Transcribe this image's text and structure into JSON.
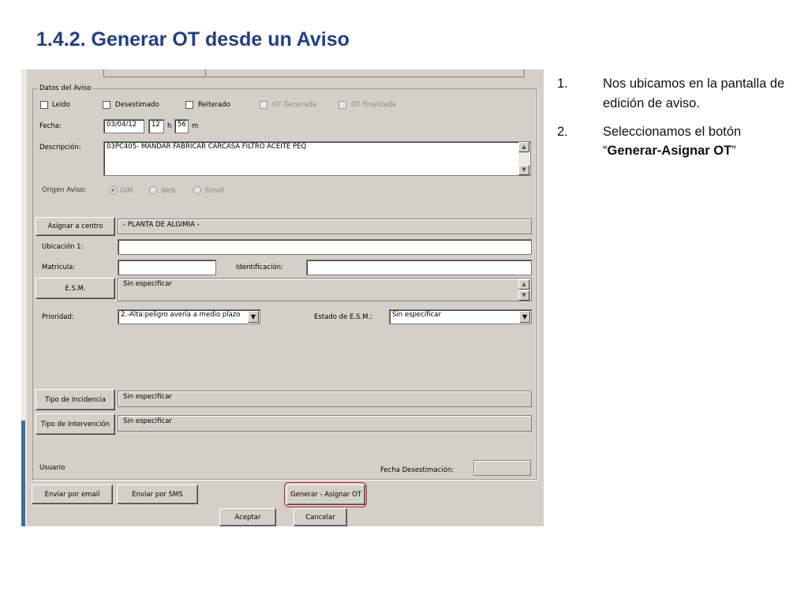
{
  "slide": {
    "title": "1.4.2. Generar OT desde un Aviso",
    "steps": [
      {
        "num": "1.",
        "text": "Nos ubicamos en la pantalla de edición de aviso."
      },
      {
        "num": "2.",
        "text_pre": "Seleccionamos el botón “",
        "text_bold": "Generar-Asignar OT",
        "text_post": "”"
      }
    ]
  },
  "form": {
    "group_label": "Datos del Aviso",
    "checkboxes": {
      "leido": "Leído",
      "desestimado": "Desestimado",
      "reiterado": "Reiterado",
      "ot_generada": "OT Generada",
      "ot_finalizada": "OT Finalizada"
    },
    "fecha": {
      "label": "Fecha:",
      "date": "03/04/12",
      "hour": "12",
      "h_label": "h",
      "minute": "56",
      "m_label": "m"
    },
    "descripcion": {
      "label": "Descripción:",
      "value": "03PC405- MANDAR FABRICAR CARCASA FILTRO ACEITE PEQ"
    },
    "origen": {
      "label": "Origen Aviso:",
      "options": [
        "GIM",
        "Web",
        "Email"
      ],
      "selected": "GIM"
    },
    "asignar_centro": {
      "button": "Asignar a centro",
      "value": "- PLANTA DE ALGIMIA -"
    },
    "ubicacion": {
      "label": "Ubicación 1:",
      "value": ""
    },
    "matricula": {
      "label": "Matrícula:",
      "value": ""
    },
    "identificacion": {
      "label": "Identificación:",
      "value": ""
    },
    "esm": {
      "button": "E.S.M.",
      "value": "Sin especificar"
    },
    "prioridad": {
      "label": "Prioridad:",
      "value": "2.-Alta:peligro avería a medio plazo"
    },
    "estado_esm": {
      "label": "Estado de E.S.M.:",
      "value": "Sin especificar"
    },
    "tipo_incidencia": {
      "button": "Tipo de Incidencia",
      "value": "Sin especificar"
    },
    "tipo_intervencion": {
      "button": "Tipo de Intervención",
      "value": "Sin especificar"
    },
    "usuario": {
      "label": "Usuario"
    },
    "fecha_desestimacion": {
      "label": "Fecha Desestimación:",
      "value": ""
    }
  },
  "buttons": {
    "email": "Enviar por email",
    "sms": "Enviar por SMS",
    "generar": "Generar - Asignar OT",
    "aceptar": "Aceptar",
    "cancelar": "Cancelar"
  },
  "colors": {
    "title": "#1f3f8c",
    "highlight": "#d21f2b",
    "window_bg": "#d4d0c8"
  }
}
